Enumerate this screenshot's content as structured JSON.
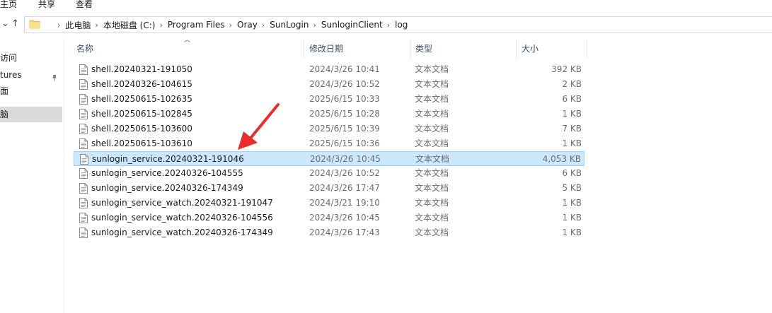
{
  "ribbon": {
    "tabs": [
      "主页",
      "共享",
      "查看"
    ]
  },
  "address": {
    "crumbs": [
      "此电脑",
      "本地磁盘 (C:)",
      "Program Files",
      "Oray",
      "SunLogin",
      "SunloginClient",
      "log"
    ]
  },
  "sidebar": {
    "items": [
      {
        "label": "访问"
      },
      {
        "label": "tures"
      },
      {
        "label": "面"
      },
      {
        "label": "脑"
      }
    ]
  },
  "columns": {
    "name": "名称",
    "date": "修改日期",
    "type": "类型",
    "size": "大小"
  },
  "files": [
    {
      "name": "shell.20240321-191050",
      "date": "2024/3/26 10:41",
      "type": "文本文档",
      "size": "392 KB"
    },
    {
      "name": "shell.20240326-104615",
      "date": "2024/3/26 10:52",
      "type": "文本文档",
      "size": "2 KB"
    },
    {
      "name": "shell.20250615-102635",
      "date": "2025/6/15 10:33",
      "type": "文本文档",
      "size": "6 KB"
    },
    {
      "name": "shell.20250615-102845",
      "date": "2025/6/15 10:28",
      "type": "文本文档",
      "size": "1 KB"
    },
    {
      "name": "shell.20250615-103600",
      "date": "2025/6/15 10:39",
      "type": "文本文档",
      "size": "7 KB"
    },
    {
      "name": "shell.20250615-103610",
      "date": "2025/6/15 10:36",
      "type": "文本文档",
      "size": "1 KB"
    },
    {
      "name": "sunlogin_service.20240321-191046",
      "date": "2024/3/26 10:45",
      "type": "文本文档",
      "size": "4,053 KB"
    },
    {
      "name": "sunlogin_service.20240326-104555",
      "date": "2024/3/26 10:52",
      "type": "文本文档",
      "size": "6 KB"
    },
    {
      "name": "sunlogin_service.20240326-174349",
      "date": "2024/3/26 17:47",
      "type": "文本文档",
      "size": "5 KB"
    },
    {
      "name": "sunlogin_service_watch.20240321-191047",
      "date": "2024/3/21 19:10",
      "type": "文本文档",
      "size": "1 KB"
    },
    {
      "name": "sunlogin_service_watch.20240326-104556",
      "date": "2024/3/26 10:45",
      "type": "文本文档",
      "size": "1 KB"
    },
    {
      "name": "sunlogin_service_watch.20240326-174349",
      "date": "2024/3/26 17:43",
      "type": "文本文档",
      "size": "1 KB"
    }
  ],
  "colors": {
    "selection": "#cce8ff",
    "selection_border": "#99d1ff",
    "annotation_arrow": "#ee2b2b"
  }
}
